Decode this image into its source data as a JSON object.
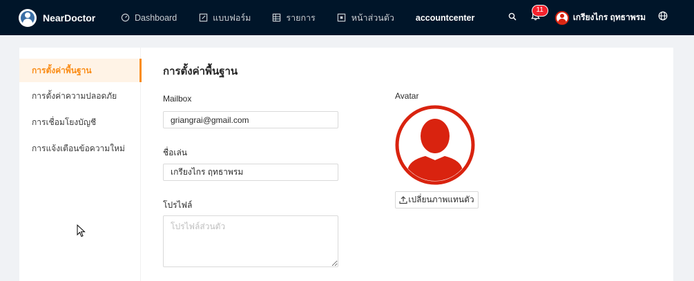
{
  "brand": {
    "name": "NearDoctor"
  },
  "nav": [
    {
      "label": "Dashboard",
      "icon": "dashboard-icon"
    },
    {
      "label": "แบบฟอร์ม",
      "icon": "form-icon"
    },
    {
      "label": "รายการ",
      "icon": "table-icon"
    },
    {
      "label": "หน้าส่วนตัว",
      "icon": "profile-icon"
    },
    {
      "label": "accountcenter",
      "icon": ""
    }
  ],
  "header": {
    "notification_count": "11",
    "user_name": "เกรียงไกร ฤทธาพรม"
  },
  "sidemenu": [
    {
      "label": "การตั้งค่าพื้นฐาน",
      "selected": true
    },
    {
      "label": "การตั้งค่าความปลอดภัย",
      "selected": false
    },
    {
      "label": "การเชื่อมโยงบัญชี",
      "selected": false
    },
    {
      "label": "การแจ้งเตือนข้อความใหม่",
      "selected": false
    }
  ],
  "form": {
    "title": "การตั้งค่าพื้นฐาน",
    "mailbox_label": "Mailbox",
    "mailbox_value": "griangrai@gmail.com",
    "nickname_label": "ชื่อเล่น",
    "nickname_value": "เกรียงไกร ฤทธาพรม",
    "profile_label": "โปรไฟล์",
    "profile_placeholder": "โปรไฟล์ส่วนตัว",
    "avatar_label": "Avatar",
    "change_avatar_button": "เปลี่ยนภาพแทนตัว"
  },
  "colors": {
    "header_bg": "#001529",
    "accent": "#fa8c16",
    "avatar_red": "#d9230f",
    "badge": "#f5222d"
  }
}
